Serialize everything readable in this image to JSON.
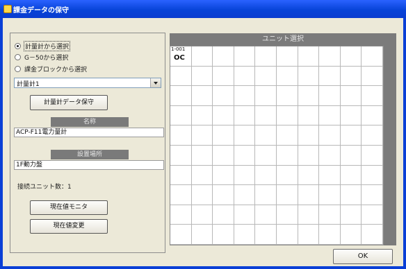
{
  "window": {
    "title": "課金データの保守"
  },
  "left": {
    "radios": [
      {
        "label": "計量計から選択",
        "selected": true
      },
      {
        "label": "G－50から選択",
        "selected": false
      },
      {
        "label": "課金ブロックから選択",
        "selected": false
      }
    ],
    "meter_select": {
      "value": "計量計1"
    },
    "save_button": "計量計データ保守",
    "name_header": "名称",
    "name_value": "ACP-F11電力量計",
    "location_header": "設置場所",
    "location_value": "1F動力盤",
    "connected_units": "接続ユニット数：1",
    "monitor_button": "現在値モニタ",
    "change_button": "現在値変更"
  },
  "unit_panel": {
    "header": "ユニット選択",
    "units": [
      {
        "id": "1-001",
        "type": "OC"
      }
    ]
  },
  "ok_button": "OK"
}
